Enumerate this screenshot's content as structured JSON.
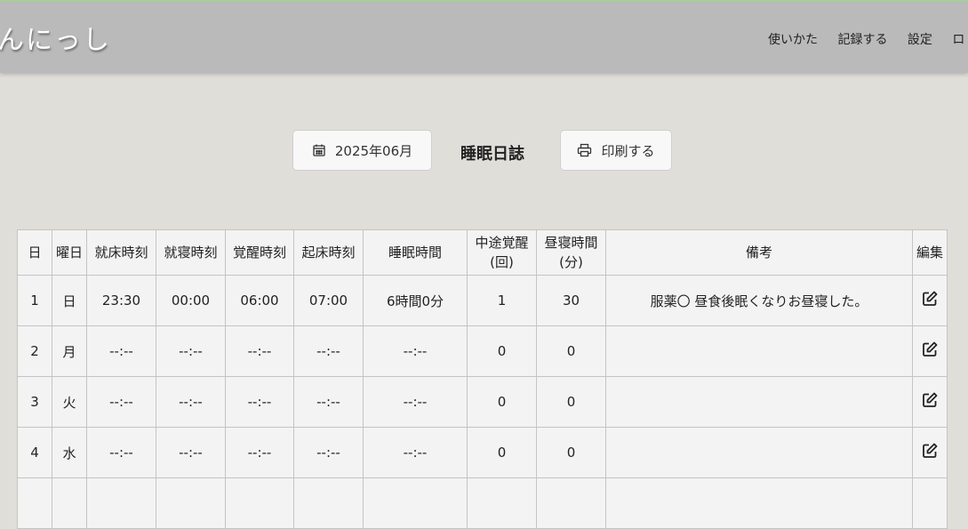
{
  "app": {
    "logo": "んにっし"
  },
  "nav": {
    "items": [
      "使いかた",
      "記録する",
      "設定",
      "ロ"
    ]
  },
  "toolbar": {
    "month_label": "2025年06月",
    "title": "睡眠日誌",
    "print_label": "印刷する"
  },
  "table": {
    "headers": {
      "day": "日",
      "weekday": "曜日",
      "bedtime": "就床時刻",
      "sleep_onset": "就寝時刻",
      "wake": "覚醒時刻",
      "rise": "起床時刻",
      "sleep_duration": "睡眠時間",
      "night_wakings_l1": "中途覚醒",
      "night_wakings_l2": "(回)",
      "nap_l1": "昼寝時間",
      "nap_l2": "(分)",
      "remarks": "備考",
      "edit": "編集"
    },
    "rows": [
      {
        "day": "1",
        "weekday": "日",
        "bedtime": "23:30",
        "sleep_onset": "00:00",
        "wake": "06:00",
        "rise": "07:00",
        "sleep_duration": "6時間0分",
        "night_wakings": "1",
        "nap": "30",
        "remarks": "服薬〇 昼食後眠くなりお昼寝した。"
      },
      {
        "day": "2",
        "weekday": "月",
        "bedtime": "--:--",
        "sleep_onset": "--:--",
        "wake": "--:--",
        "rise": "--:--",
        "sleep_duration": "--:--",
        "night_wakings": "0",
        "nap": "0",
        "remarks": ""
      },
      {
        "day": "3",
        "weekday": "火",
        "bedtime": "--:--",
        "sleep_onset": "--:--",
        "wake": "--:--",
        "rise": "--:--",
        "sleep_duration": "--:--",
        "night_wakings": "0",
        "nap": "0",
        "remarks": ""
      },
      {
        "day": "4",
        "weekday": "水",
        "bedtime": "--:--",
        "sleep_onset": "--:--",
        "wake": "--:--",
        "rise": "--:--",
        "sleep_duration": "--:--",
        "night_wakings": "0",
        "nap": "0",
        "remarks": ""
      },
      {
        "day": "",
        "weekday": "",
        "bedtime": "",
        "sleep_onset": "",
        "wake": "",
        "rise": "",
        "sleep_duration": "",
        "night_wakings": "",
        "nap": "",
        "remarks": ""
      }
    ]
  },
  "icons": {
    "month": "calendar-icon",
    "print": "printer-icon",
    "edit": "edit-icon"
  }
}
